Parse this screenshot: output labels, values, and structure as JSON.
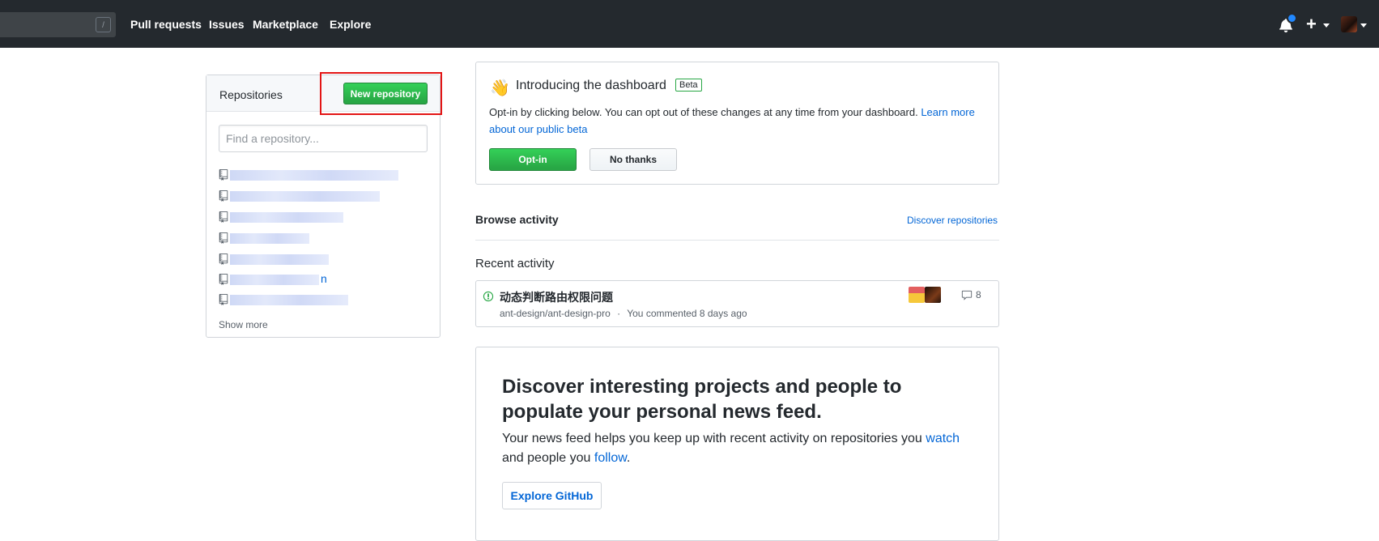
{
  "header": {
    "slash_key": "/",
    "nav": [
      "Pull requests",
      "Issues",
      "Marketplace",
      "Explore"
    ],
    "plus_label": "+"
  },
  "sidebar": {
    "title": "Repositories",
    "new_repo_label": "New repository",
    "search_placeholder": "Find a repository...",
    "repo_visible_suffix": "n",
    "show_more": "Show more"
  },
  "dashboard": {
    "wave_emoji": "👋",
    "title": "Introducing the dashboard",
    "badge": "Beta",
    "desc": "Opt-in by clicking below. You can opt out of these changes at any time from your dashboard. ",
    "learn_more": "Learn more about our public beta",
    "optin": "Opt-in",
    "nothanks": "No thanks"
  },
  "browse": {
    "title": "Browse activity",
    "discover_link": "Discover repositories"
  },
  "recent": {
    "title": "Recent activity",
    "issue_title": "动态判断路由权限问题",
    "repo": "ant-design/ant-design-pro",
    "separator": "·",
    "meta": "You commented 8 days ago",
    "comment_count": "8"
  },
  "discover": {
    "heading": "Discover interesting projects and people to populate your personal news feed.",
    "text_prefix": "Your news feed helps you keep up with recent activity on repositories you ",
    "watch": "watch",
    "text_mid": " and people you ",
    "follow": "follow",
    "text_end": ".",
    "button": "Explore GitHub"
  },
  "colors": {
    "header_bg": "#24292e",
    "primary_green": "#28a745",
    "link_blue": "#0366d6",
    "highlight_red": "#e31515"
  }
}
